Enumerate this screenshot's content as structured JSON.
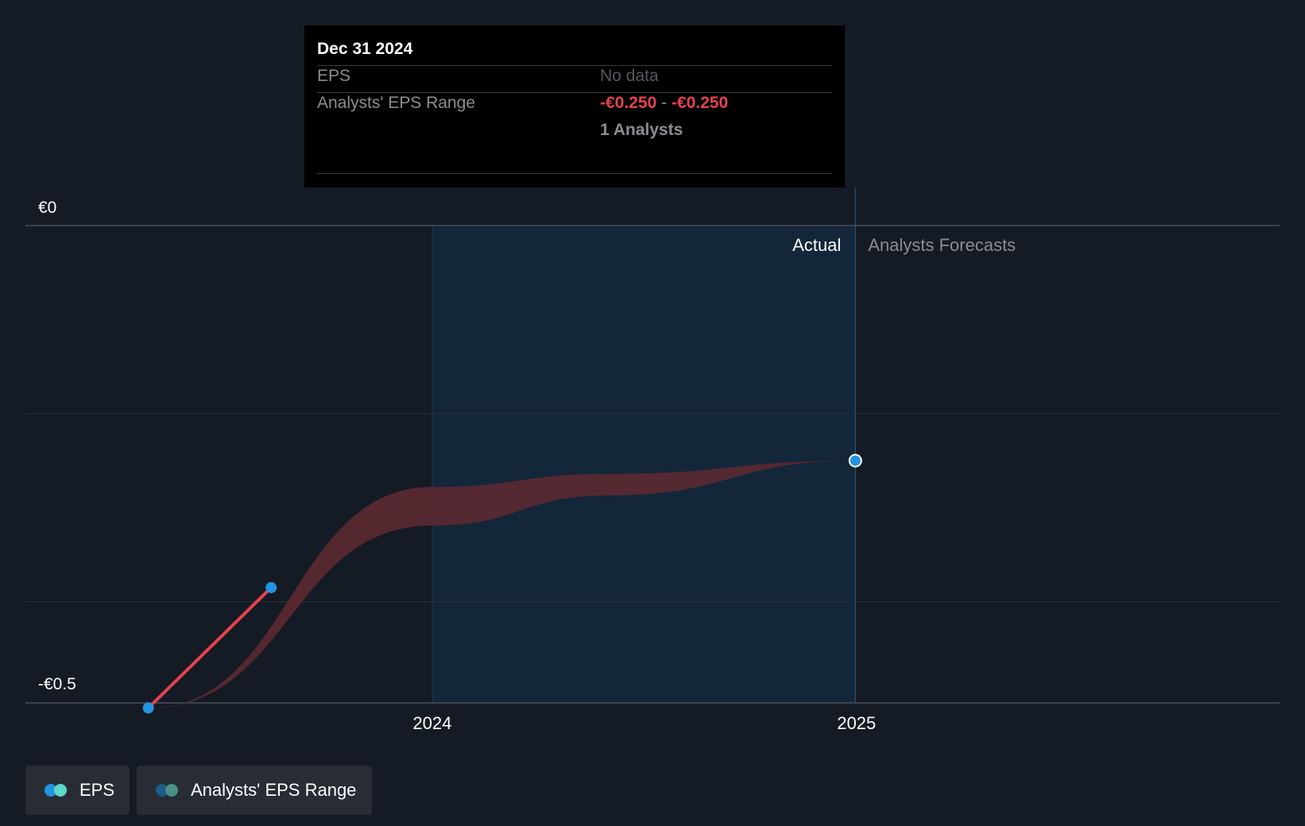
{
  "tooltip": {
    "date": "Dec 31 2024",
    "rows": [
      {
        "label": "EPS",
        "value": "No data"
      },
      {
        "label": "Analysts' EPS Range",
        "low": "-€0.250",
        "separator": "-",
        "high": "-€0.250"
      }
    ],
    "analysts": "1 Analysts"
  },
  "regions": {
    "actual": "Actual",
    "forecast": "Analysts Forecasts"
  },
  "legend": {
    "eps": {
      "label": "EPS",
      "colors": [
        "#2394e0",
        "#5fd7c9"
      ]
    },
    "range": {
      "label": "Analysts' EPS Range",
      "colors": [
        "#1f5b85",
        "#4a8f86"
      ]
    }
  },
  "colors": {
    "background": "#151b24",
    "actual_region": "#13263a",
    "eps_line": "#e5424d",
    "eps_point": "#2394e0",
    "range_band": "#5c2a32"
  },
  "chart_data": {
    "type": "line",
    "x_ticks": [
      "2024",
      "2025"
    ],
    "y_ticks": [
      "€0",
      "-€0.5"
    ],
    "ylim": [
      -0.5,
      0
    ],
    "xlim": [
      "2023-01-15",
      "2026-01-01"
    ],
    "actual_region": [
      "2024-01-01",
      "2024-12-31"
    ],
    "series": [
      {
        "name": "EPS",
        "points": [
          {
            "x": "2023-05-01",
            "y": -0.513
          },
          {
            "x": "2023-08-15",
            "y": -0.385
          }
        ]
      },
      {
        "name": "Analysts' EPS Range",
        "type": "area",
        "points": [
          {
            "x": "2023-05-01",
            "low": -0.513,
            "high": -0.513
          },
          {
            "x": "2024-01-01",
            "low": -0.319,
            "high": -0.278
          },
          {
            "x": "2024-06-01",
            "low": -0.287,
            "high": -0.264
          },
          {
            "x": "2024-12-31",
            "low": -0.25,
            "high": -0.25
          }
        ]
      }
    ]
  }
}
